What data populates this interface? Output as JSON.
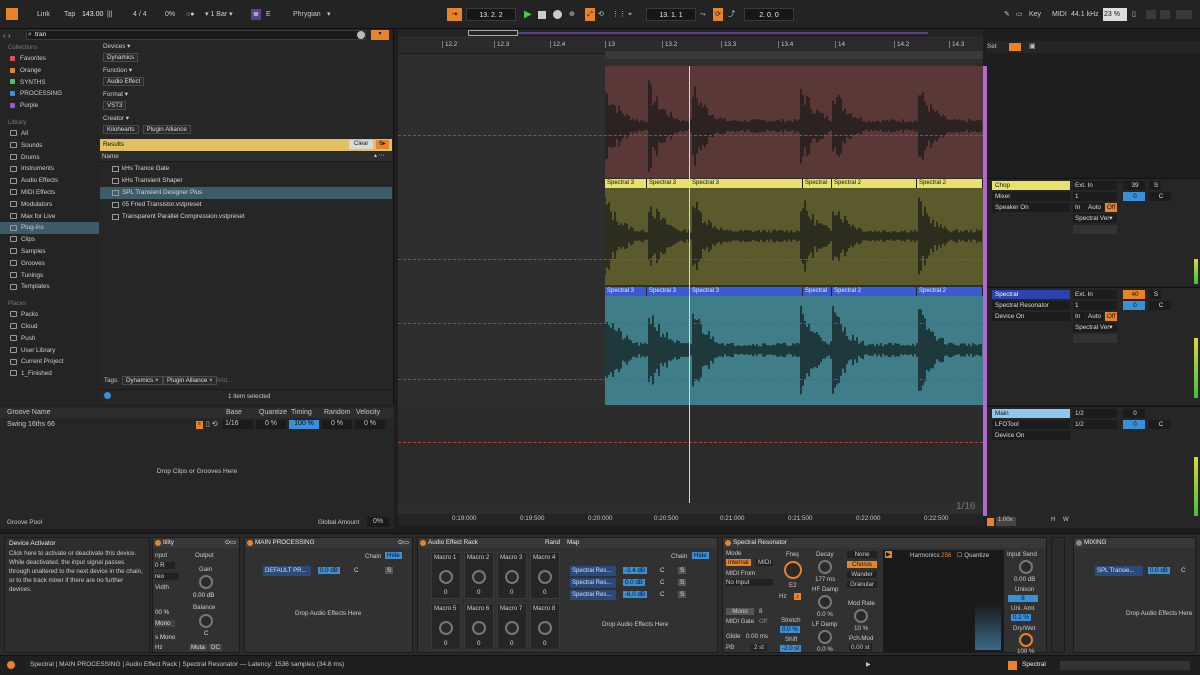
{
  "top": {
    "link": "Link",
    "tap": "Tap",
    "tempo": "143.00",
    "sig": "4 / 4",
    "pct": "0%",
    "quant": "1 Bar",
    "key": "E",
    "scale": "Phrygian",
    "pos1": "13.  2.  2",
    "pos2": "13.  1.  1",
    "pos3": "2.  0.  0",
    "keylbl": "Key",
    "midi": "MIDI",
    "rate": "44.1 kHz",
    "cpu": "23 %"
  },
  "browser": {
    "search": "tran",
    "collections_h": "Collections",
    "collections": [
      {
        "label": "Favorites",
        "color": "#e05050"
      },
      {
        "label": "Orange",
        "color": "#e8832a"
      },
      {
        "label": "SYNTHS",
        "color": "#50c060"
      },
      {
        "label": "PROCESSING",
        "color": "#3b8fd8"
      },
      {
        "label": "Purple",
        "color": "#9b5bd0"
      }
    ],
    "library_h": "Library",
    "library": [
      "All",
      "Sounds",
      "Drums",
      "Instruments",
      "Audio Effects",
      "MIDI Effects",
      "Modulators",
      "Max for Live",
      "Plug-ins",
      "Clips",
      "Samples",
      "Grooves",
      "Tunings",
      "Templates"
    ],
    "places_h": "Places",
    "places": [
      "Packs",
      "Cloud",
      "Push",
      "User Library",
      "Current Project",
      "1_Finished"
    ],
    "filters": [
      {
        "label": "Devices ▾",
        "tags": [
          "Dynamics"
        ]
      },
      {
        "label": "Function ▾",
        "tags": [
          "Audio Effect"
        ]
      },
      {
        "label": "Format ▾",
        "tags": [
          "VST3"
        ]
      },
      {
        "label": "Creator ▾",
        "tags": [
          "Kilohearts",
          "Plugin Alliance"
        ]
      }
    ],
    "results": "Results",
    "clear": "Clear",
    "name_h": "Name",
    "items": [
      "kHs Trance Gate",
      "kHs Transient Shaper",
      "SPL Transient Designer Plus",
      "05 Fried Transistor.vstpreset",
      "Transparent Parallel Compression.vstpreset"
    ],
    "tags_lbl": "Tags:",
    "tags": [
      "Dynamics",
      "Plugin Alliance"
    ],
    "add": "Add...",
    "selected": "1 item selected"
  },
  "groove": {
    "headers": [
      "Groove Name",
      "Base",
      "Quantize",
      "Timing",
      "Random",
      "Velocity"
    ],
    "row": [
      "Swing 16ths 66",
      "1/16",
      "0 %",
      "100 %",
      "0 %",
      "0 %"
    ],
    "drop": "Drop Clips or Grooves Here",
    "pool": "Groove Pool",
    "amount_lbl": "Global Amount",
    "amount": "0%"
  },
  "arr": {
    "ruler": [
      "12.2",
      "12.3",
      "12.4",
      "13",
      "13.2",
      "13.3",
      "13.4",
      "14",
      "14.2",
      "14.3"
    ],
    "time": [
      "0:19:000",
      "0:19:500",
      "0:20:000",
      "0:20:500",
      "0:21:000",
      "0:21:500",
      "0:22:000",
      "0:22:500"
    ],
    "set": "Set",
    "grid": "1/16",
    "zoom": "1.00x",
    "labels": [
      "Spectral 3",
      "Spectral 3",
      "Spectral 3",
      "Spectral",
      "Spectral 2",
      "Spectral 2"
    ]
  },
  "mixer": [
    {
      "name": "Chop",
      "color": "#e8e26a",
      "p1": "Mixer",
      "p2": "Speaker On",
      "in": "Ext. In",
      "ch": "1",
      "mon": "In",
      "auto": "Auto",
      "off": "Off",
      "out": "Spectral Ver▾",
      "vol": "39",
      "pan": "C",
      "sol": "S"
    },
    {
      "name": "Spectral",
      "color": "#2a43b0",
      "p1": "Spectral Resonator",
      "p2": "Device On",
      "in": "Ext. In",
      "ch": "1",
      "mon": "In",
      "auto": "Auto",
      "off": "Off",
      "out": "Spectral Ver▾",
      "vol": "40",
      "pan": "C",
      "sol": "S"
    },
    {
      "name": "Main",
      "color": "#8ec6f0",
      "p1": "LFOTool",
      "p2": "Device On",
      "in": "1/2",
      "ch": "1/2",
      "vol": "0",
      "pan": "C"
    }
  ],
  "dev": {
    "activator_t": "Device Activator",
    "activator_d": "Click here to activate or deactivate this device. While deactivated, the input signal passes through unaltered to the next device in the chain, or to the track mixer if there are no further devices.",
    "util": {
      "title": "tility",
      "input": "nput",
      "output": "Output",
      "gain": "Gain",
      "gainv": "0.00 dB",
      "width": "Vidth",
      "widthv": "00 %",
      "balance": "Balance",
      "balv": "C",
      "mono": "Mono",
      "bass": "s Mono",
      "hz": "Hz",
      "muta": "Muta",
      "dc": "DC",
      "stereo": "reo"
    },
    "mp": {
      "title": "MAIN PROCESSING",
      "chain": "Chain",
      "hide": "Hide",
      "preset": "DEFAULT PR...",
      "db": "0.0 dB",
      "c": "C",
      "s": "S",
      "drop": "Drop Audio Effects Here"
    },
    "rack": {
      "title": "Audio Effect Rack",
      "rand": "Rand",
      "map": "Map",
      "macros": [
        "Macro 1",
        "Macro 2",
        "Macro 3",
        "Macro 4",
        "Macro 5",
        "Macro 6",
        "Macro 7",
        "Macro 8"
      ],
      "mv": "0",
      "chain": "Chain",
      "hide": "Hide",
      "chains": [
        {
          "n": "Spectral Res...",
          "v": "-3.4 dB"
        },
        {
          "n": "Spectral Res...",
          "v": "0.0 dB"
        },
        {
          "n": "Spectral Res...",
          "v": "-6.0 dB"
        }
      ],
      "c": "C",
      "drop": "Drop Audio Effects Here"
    },
    "sr": {
      "title": "Spectral Resonator",
      "mode": "Mode",
      "internal": "Internal",
      "midi": "MIDI",
      "midifrom": "MIDI From",
      "noinput": "No Input",
      "mono": "Mono",
      "voices": "8",
      "gate": "MIDI Gate",
      "off": "Off",
      "glide": "Glide",
      "glidev": "0.00 ms",
      "pb": "PB",
      "pbv": "2 st",
      "freq": "Freq",
      "note": "E2",
      "hz": "Hz",
      "decay": "Decay",
      "decayv": "177 ms",
      "hfdamp": "HF Damp",
      "hfv": "0.0 %",
      "lfdamp": "LF Damp",
      "lfv": "0.0 %",
      "stretch": "Stretch",
      "stv": "0.0 %",
      "shift": "Shift",
      "shv": "-2.0 st",
      "modes": [
        "None",
        "Chorus",
        "Wander",
        "Granular"
      ],
      "modrate": "Mod Rate",
      "modv": "10 %",
      "pch": "Pch.Mod",
      "pchv": "0.00 st",
      "harm": "Harmonics",
      "harmv": "256",
      "quant": "Quantize",
      "isend": "Input Send",
      "isv": "0.00 dB",
      "unison": "Unison",
      "unv": "8",
      "uni": "Uni. Amt",
      "univ": "0.1 %",
      "dw": "Dry/Wet",
      "dwv": "100 %"
    },
    "mixing": {
      "title": "MIXING",
      "preset": "SPL Transie...",
      "db": "0.0 dB",
      "c": "C",
      "drop": "Drop Audio Effects Here"
    }
  },
  "status": {
    "text": "Spectral | MAIN PROCESSING | Audio Effect Rack | Spectral Resonator — Latency: 1536 samples (34.8 ms)",
    "track": "Spectral"
  }
}
